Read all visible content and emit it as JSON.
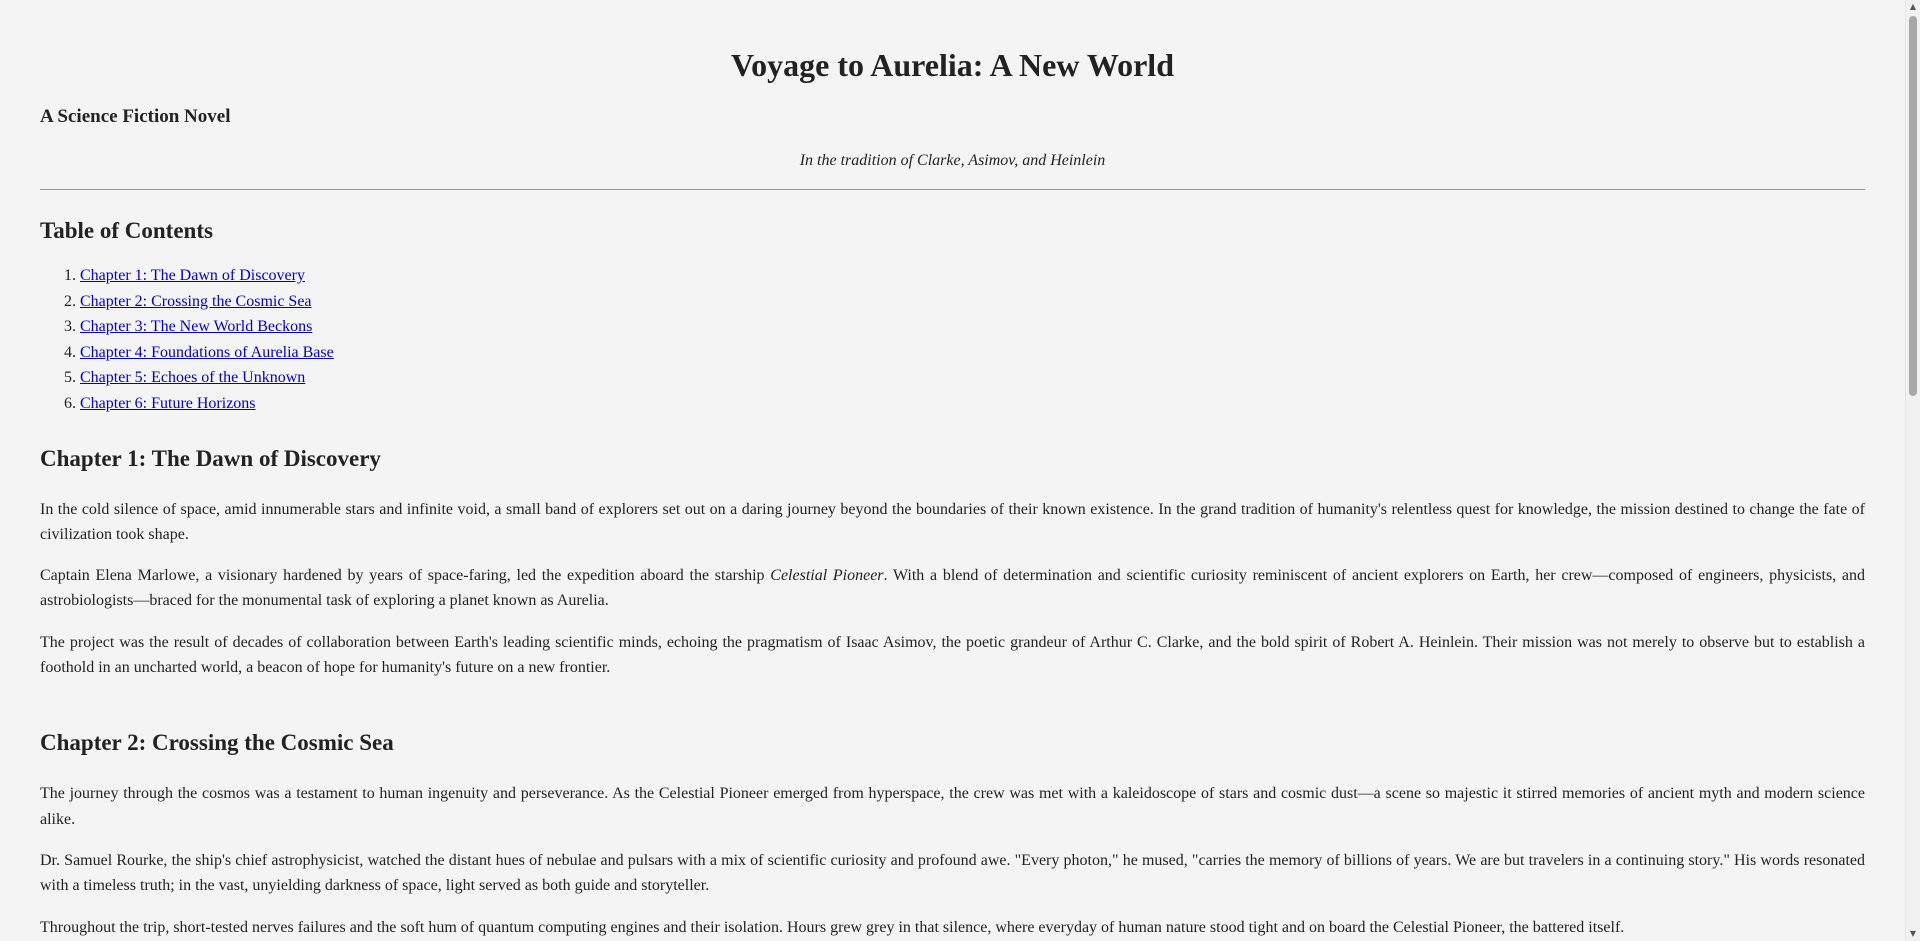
{
  "header": {
    "title": "Voyage to Aurelia: A New World",
    "subtitle": "A Science Fiction Novel",
    "tagline": "In the tradition of Clarke, Asimov, and Heinlein"
  },
  "toc": {
    "title": "Table of Contents",
    "items": [
      {
        "number": "1.",
        "label": "Chapter 1: The Dawn of Discovery"
      },
      {
        "number": "2.",
        "label": "Chapter 2: Crossing the Cosmic Sea"
      },
      {
        "number": "3.",
        "label": "Chapter 3: The New World Beckons"
      },
      {
        "number": "4.",
        "label": "Chapter 4: Foundations of Aurelia Base"
      },
      {
        "number": "5.",
        "label": "Chapter 5: Echoes of the Unknown"
      },
      {
        "number": "6.",
        "label": "Chapter 6: Future Horizons"
      }
    ]
  },
  "chapters": [
    {
      "title": "Chapter 1: The Dawn of Discovery",
      "paragraphs": [
        {
          "text": "In the cold silence of space, amid innumerable stars and infinite void, a small band of explorers set out on a daring journey beyond the boundaries of their known existence. In the grand tradition of humanity's relentless quest for knowledge, the mission destined to change the fate of civilization took shape."
        },
        {
          "before": "Captain Elena Marlowe, a visionary hardened by years of space-faring, led the expedition aboard the starship ",
          "em": "Celestial Pioneer",
          "after": ". With a blend of determination and scientific curiosity reminiscent of ancient explorers on Earth, her crew—composed of engineers, physicists, and astrobiologists—braced for the monumental task of exploring a planet known as Aurelia."
        },
        {
          "text": "The project was the result of decades of collaboration between Earth's leading scientific minds, echoing the pragmatism of Isaac Asimov, the poetic grandeur of Arthur C. Clarke, and the bold spirit of Robert A. Heinlein. Their mission was not merely to observe but to establish a foothold in an uncharted world, a beacon of hope for humanity's future on a new frontier."
        }
      ]
    },
    {
      "title": "Chapter 2: Crossing the Cosmic Sea",
      "paragraphs": [
        {
          "text": "The journey through the cosmos was a testament to human ingenuity and perseverance. As the Celestial Pioneer emerged from hyperspace, the crew was met with a kaleidoscope of stars and cosmic dust—a scene so majestic it stirred memories of ancient myth and modern science alike."
        },
        {
          "text": "Dr. Samuel Rourke, the ship's chief astrophysicist, watched the distant hues of nebulae and pulsars with a mix of scientific curiosity and profound awe. \"Every photon,\" he mused, \"carries the memory of billions of years. We are but travelers in a continuing story.\" His words resonated with a timeless truth; in the vast, unyielding darkness of space, light served as both guide and storyteller."
        },
        {
          "text": "Throughout the trip, short-tested nerves failures and the soft hum of quantum computing engines and their isolation. Hours grew grey in that silence, where everyday of human nature stood tight and on board the Celestial Pioneer, the battered itself."
        }
      ]
    }
  ],
  "scrollbar": {
    "up_icon": "▲",
    "down_icon": "▼"
  }
}
